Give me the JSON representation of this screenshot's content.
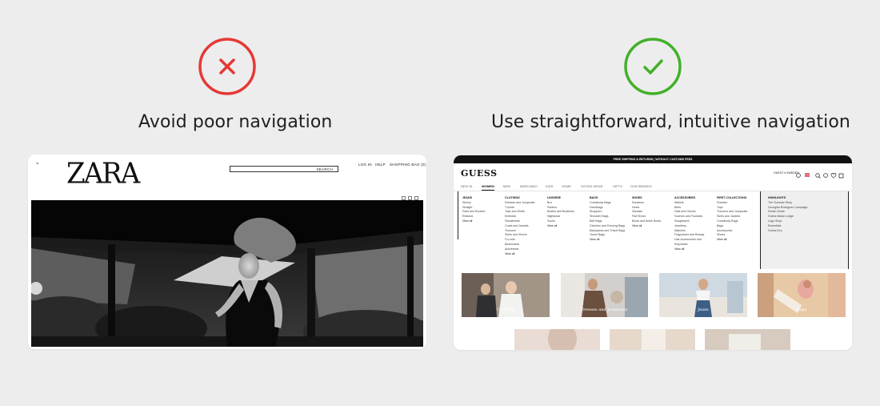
{
  "left": {
    "heading": "Avoid poor navigation",
    "icon": "x-circle-icon",
    "color": "#e53935",
    "zara": {
      "logo": "ZARA",
      "menu_icon": "=",
      "search_label": "SEARCH",
      "links": [
        "LOG IN",
        "HELP",
        "SHOPPING BAG (0)"
      ]
    }
  },
  "right": {
    "heading": "Use straightforward, intuitive navigation",
    "icon": "check-circle-icon",
    "color": "#43b02a",
    "guess": {
      "banner": "FREE SHIPPING & RETURNS | WITHOUT CUSTOMS FEES",
      "logo": "GUESS",
      "tabs": [
        "NEW IN",
        "WOMEN",
        "MEN",
        "MARCIANO",
        "KIDS",
        "HOME",
        "GOOD4 WEAR",
        "GIFTS",
        "OUR BRANDS"
      ],
      "region": "GUEST ▾ SWEDEN",
      "menu_columns": [
        {
          "title": "JEANS",
          "items": [
            "Skinny",
            "Straight",
            "Flare and Bootcut",
            "Relaxed",
            "View all"
          ]
        },
        {
          "title": "CLOTHING",
          "items": [
            "Dresses and Jumpsuits",
            "T-shirts",
            "Tops and Shirts",
            "Knitwear",
            "Sweatshirts",
            "Coats and Jackets",
            "Trousers",
            "Skirts and Shorts",
            "Co-ords",
            "Beachwear",
            "Activewear",
            "View all"
          ]
        },
        {
          "title": "LINGERIE",
          "items": [
            "Bra",
            "Panties",
            "Bodies and Bustieres",
            "Nightwear",
            "Socks",
            "View all"
          ]
        },
        {
          "title": "BAGS",
          "items": [
            "Crossbody Bags",
            "Handbags",
            "Shoppers",
            "Shoulder Bags",
            "Belt Bags",
            "Clutches and Evening Bags",
            "Backpacks and Travel Bags",
            "Travel Bags",
            "View all"
          ]
        },
        {
          "title": "SHOES",
          "items": [
            "Sneakers",
            "Heels",
            "Sandals",
            "Flat Shoes",
            "Boots and Ankle Boots",
            "View all"
          ]
        },
        {
          "title": "ACCESSORIES",
          "items": [
            "Wallets",
            "Belts",
            "Hats and Gloves",
            "Scarves and Foulards",
            "Sunglasses",
            "Jewellery",
            "Watches",
            "Fragrances and Beauty",
            "Hair Accessories and Keychains",
            "View all"
          ]
        },
        {
          "title": "FIRST COLLECTIONS",
          "items": [
            "Dresses",
            "Tops",
            "Trousers and Jumpsuits",
            "Skirts and Jackets",
            "Crossbody Bags",
            "Bags",
            "Accessories",
            "Shoes",
            "View all"
          ]
        },
        {
          "title": "HIGHLIGHTS",
          "items": [
            "The Summer Shop",
            "Georgina Rodriguez Campaign",
            "Denim Guide",
            "Guess Italian Lodge",
            "Logo Shop",
            "Essentials",
            "Guess Eco"
          ]
        }
      ],
      "tiles": [
        "Clothing",
        "Dresses and Jumpsuits",
        "Jeans",
        "Bags"
      ]
    }
  }
}
